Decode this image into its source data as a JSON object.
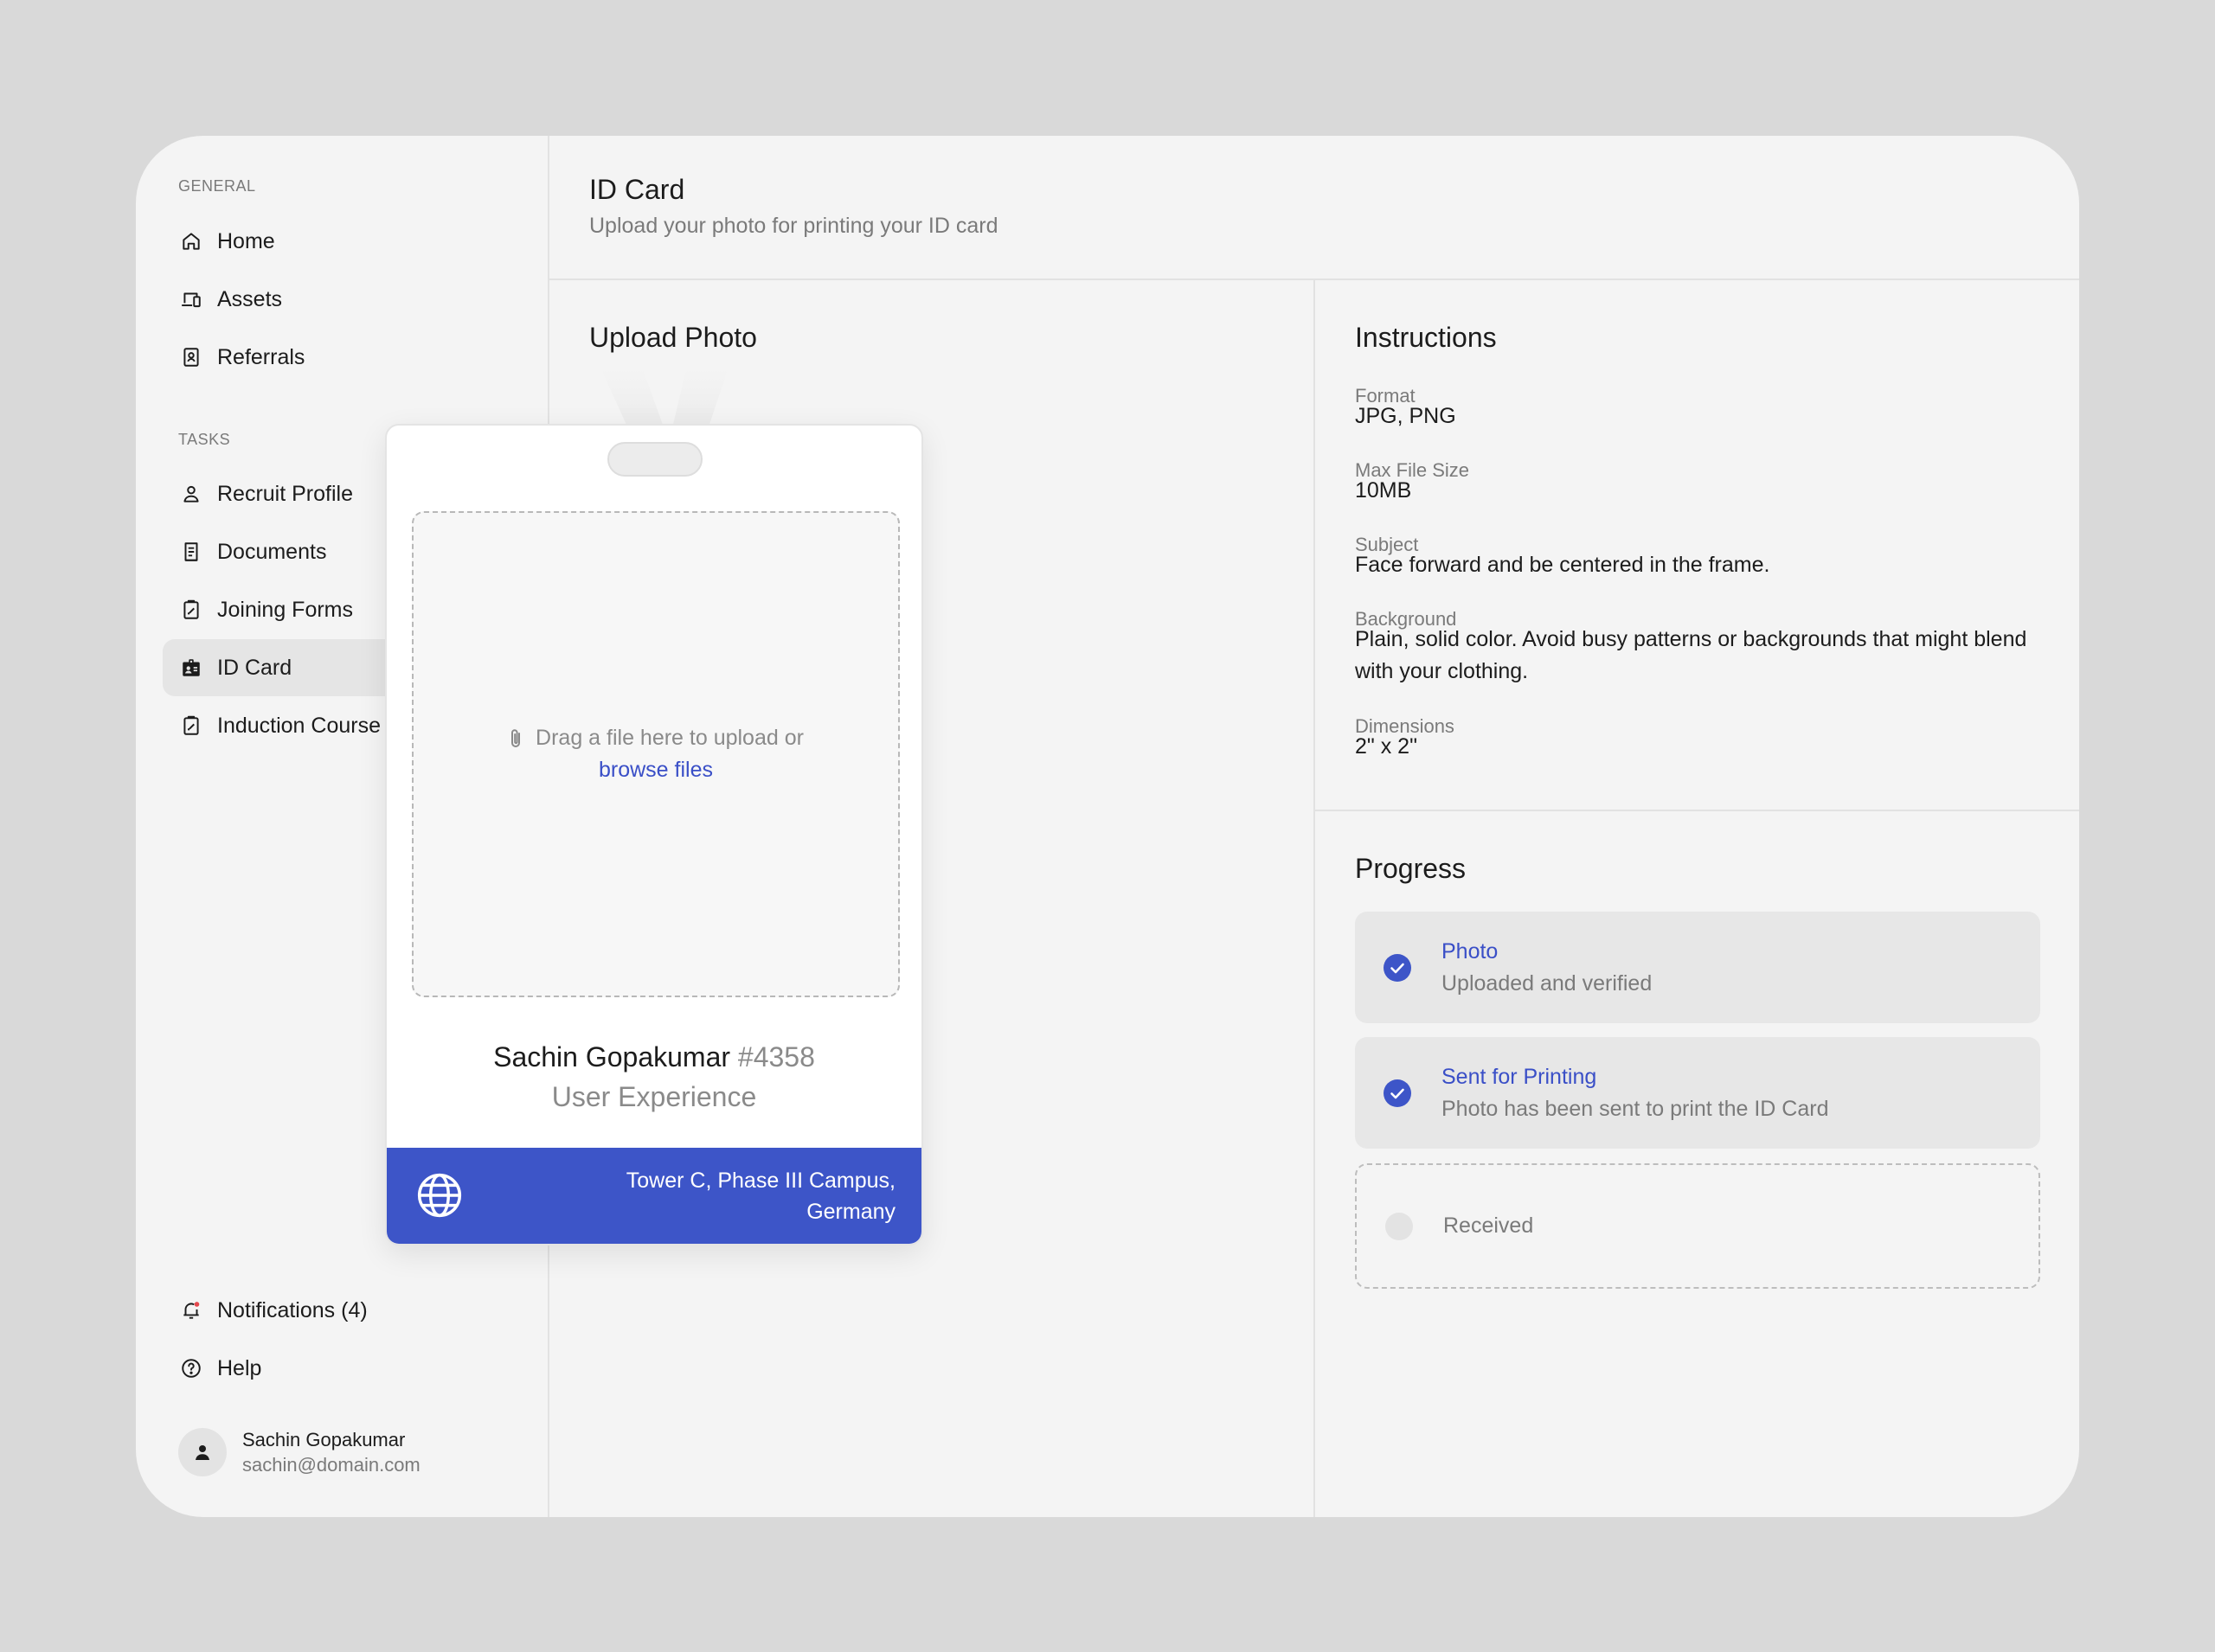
{
  "sidebar": {
    "general_label": "GENERAL",
    "general_items": [
      {
        "label": "Home",
        "icon": "home-icon"
      },
      {
        "label": "Assets",
        "icon": "devices-icon"
      },
      {
        "label": "Referrals",
        "icon": "contact-book-icon"
      }
    ],
    "tasks_label": "TASKS",
    "task_items": [
      {
        "label": "Recruit Profile",
        "icon": "user-icon"
      },
      {
        "label": "Documents",
        "icon": "document-icon"
      },
      {
        "label": "Joining Forms",
        "icon": "clipboard-edit-icon"
      },
      {
        "label": "ID Card",
        "icon": "id-badge-icon",
        "active": true
      },
      {
        "label": "Induction Course",
        "icon": "clipboard-edit-icon"
      }
    ],
    "bottom_items": [
      {
        "label": "Notifications (4)",
        "icon": "bell-icon"
      },
      {
        "label": "Help",
        "icon": "help-circle-icon"
      }
    ],
    "user": {
      "name": "Sachin Gopakumar",
      "email": "sachin@domain.com"
    }
  },
  "header": {
    "title": "ID Card",
    "subtitle": "Upload your photo for printing your ID card"
  },
  "upload": {
    "title": "Upload Photo",
    "drop_text": "Drag a file here to upload or",
    "browse_label": "browse files",
    "holder_name": "Sachin Gopakumar",
    "holder_id": "#4358",
    "department": "User Experience",
    "address_line1": "Tower C, Phase III Campus,",
    "address_line2": "Germany"
  },
  "instructions": {
    "title": "Instructions",
    "fields": [
      {
        "label": "Format",
        "value": "JPG, PNG"
      },
      {
        "label": "Max File Size",
        "value": "10MB"
      },
      {
        "label": "Subject",
        "value": "Face forward and be centered in the frame."
      },
      {
        "label": "Background",
        "value": "Plain, solid color. Avoid busy patterns or backgrounds that might blend with your clothing."
      },
      {
        "label": "Dimensions",
        "value": "2\" x 2\""
      }
    ]
  },
  "progress": {
    "title": "Progress",
    "steps": [
      {
        "name": "Photo",
        "description": "Uploaded and verified",
        "status": "done"
      },
      {
        "name": "Sent for Printing",
        "description": "Photo has been sent to print the ID Card",
        "status": "done"
      },
      {
        "name": "Received",
        "description": "",
        "status": "pending"
      }
    ]
  },
  "colors": {
    "accent": "#3d55c8",
    "link": "#3a4fc7",
    "notification_dot": "#e5484d",
    "background": "#d9d9d9",
    "panel": "#f4f4f4"
  }
}
